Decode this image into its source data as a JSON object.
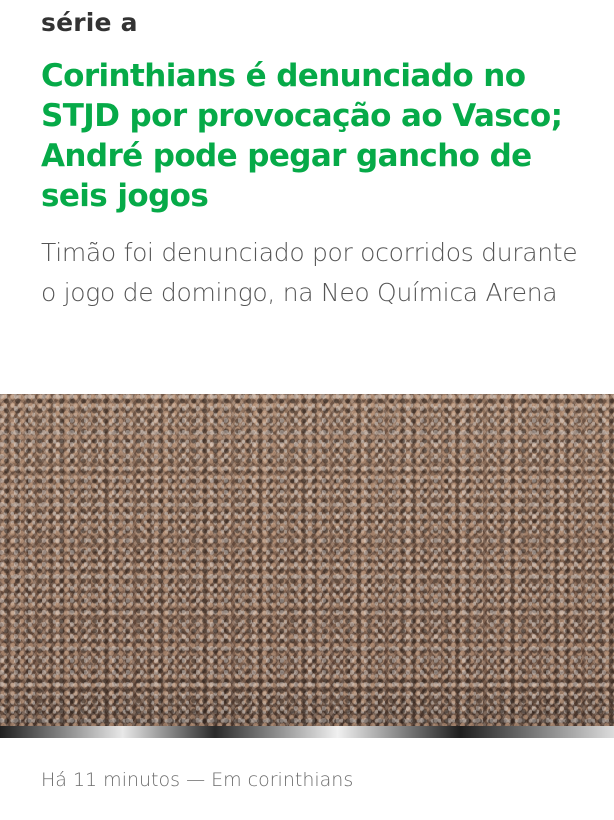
{
  "article": {
    "section": "série a",
    "headline": "Corinthians é denunciado no STJD por provocação ao Vasco; André pode pegar gancho de seis jogos",
    "subtitle": "Timão foi denunciado por ocorridos durante o jogo de domingo, na Neo Química Arena",
    "image": {
      "description": "torcida-corinthians-estadio"
    },
    "meta": {
      "time": "Há 11 minutos",
      "separator": " — ",
      "category": "Em corinthians"
    }
  },
  "colors": {
    "headline": "#06aa48",
    "section": "#333333",
    "subtitle": "#555555",
    "meta": "#6b6b6b"
  }
}
